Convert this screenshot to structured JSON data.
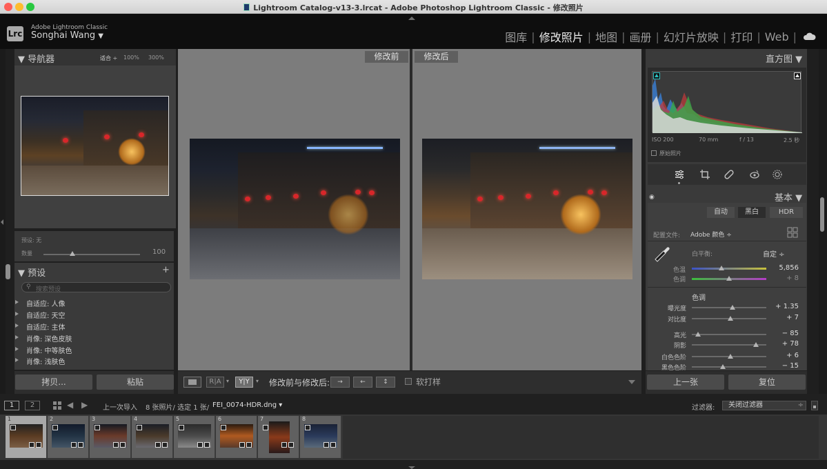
{
  "window": {
    "title": "Lightroom Catalog-v13-3.lrcat - Adobe Photoshop Lightroom Classic - 修改照片"
  },
  "identity": {
    "logo": "Lrc",
    "brand": "Adobe Lightroom Classic",
    "user": "Songhai Wang"
  },
  "modules": [
    "图库",
    "修改照片",
    "地图",
    "画册",
    "幻灯片放映",
    "打印",
    "Web"
  ],
  "active_module": "修改照片",
  "navigator": {
    "title": "导航器",
    "fit": "适合",
    "z1": "100%",
    "z2": "300%"
  },
  "preset_amount": {
    "preset_label": "预设: 无",
    "amount_label": "数量",
    "amount_value": "100",
    "amount_fraction": 0.3
  },
  "presets": {
    "title": "预设",
    "add": "+",
    "search_placeholder": "搜索预设",
    "items": [
      "自适应: 人像",
      "自适应: 天空",
      "自适应: 主体",
      "肖像: 深色皮肤",
      "肖像: 中等肤色",
      "肖像: 浅肤色"
    ]
  },
  "left_buttons": {
    "copy": "拷贝...",
    "paste": "粘贴"
  },
  "compare": {
    "before": "修改前",
    "after": "修改后"
  },
  "center_toolbar": {
    "mode_label": "修改前与修改后:",
    "soft_proof": "软打样",
    "ra": "R|A",
    "yy": "Y|Y"
  },
  "histogram": {
    "title": "直方图",
    "iso": "ISO 200",
    "focal": "70 mm",
    "aperture": "f / 13",
    "shutter": "2.5 秒",
    "original": "原始照片"
  },
  "basic": {
    "title": "基本",
    "auto": "自动",
    "bw": "黑白",
    "hdr": "HDR",
    "profile_label": "配置文件:",
    "profile_value": "Adobe 颜色",
    "wb_label": "白平衡:",
    "wb_value": "自定",
    "temp_label": "色温",
    "temp_value": "5,856",
    "tint_label": "色调",
    "tint_value": "+ 8",
    "tone_label": "色调",
    "sliders": [
      {
        "label": "曝光度",
        "value": "+ 1.35",
        "pos": 0.55
      },
      {
        "label": "对比度",
        "value": "+ 7",
        "pos": 0.52
      },
      {
        "label": "高光",
        "value": "− 85",
        "pos": 0.08
      },
      {
        "label": "阴影",
        "value": "+ 78",
        "pos": 0.86
      },
      {
        "label": "白色色阶",
        "value": "+ 6",
        "pos": 0.52
      },
      {
        "label": "黑色色阶",
        "value": "− 15",
        "pos": 0.42
      }
    ],
    "temp_pos": 0.4,
    "tint_pos": 0.5
  },
  "right_buttons": {
    "prev": "上一张",
    "reset": "复位"
  },
  "filmstrip": {
    "page1": "1",
    "page2": "2",
    "source": "上一次导入",
    "count": "8 张照片/ 选定 1 张/",
    "file": "FEI_0074-HDR.dng",
    "filter_label": "过滤器:",
    "filter_value": "关闭过滤器",
    "thumbs": [
      "1",
      "2",
      "3",
      "4",
      "5",
      "6",
      "7",
      "8"
    ]
  },
  "colors": {
    "accent": "#c8c8c8",
    "temp_start": "#3b52c8",
    "temp_end": "#c8c23b",
    "tint_start": "#3bbf3b",
    "tint_end": "#b53bc8"
  }
}
